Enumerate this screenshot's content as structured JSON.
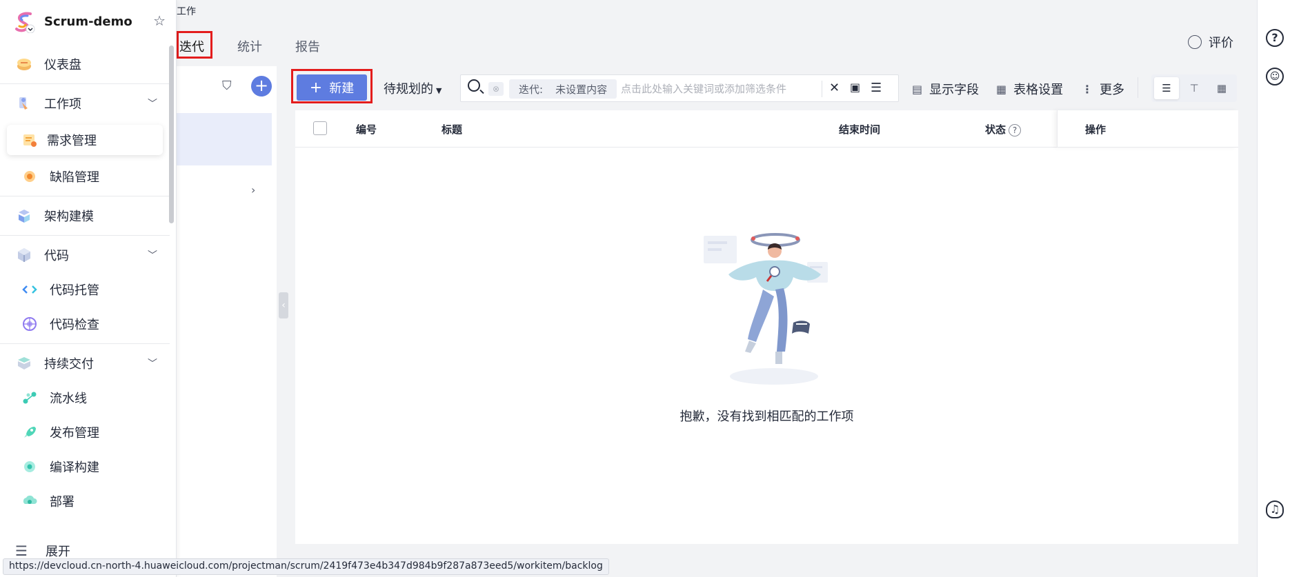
{
  "project": {
    "name": "Scrum-demo"
  },
  "sidebar": {
    "items": [
      {
        "label": "仪表盘"
      },
      {
        "label": "工作项"
      },
      {
        "label": "需求管理"
      },
      {
        "label": "缺陷管理"
      },
      {
        "label": "架构建模"
      },
      {
        "label": "代码"
      },
      {
        "label": "代码托管"
      },
      {
        "label": "代码检查"
      },
      {
        "label": "持续交付"
      },
      {
        "label": "流水线"
      },
      {
        "label": "发布管理"
      },
      {
        "label": "编译构建"
      },
      {
        "label": "部署"
      }
    ],
    "expand_label": "展开"
  },
  "breadcrumb": "工作",
  "tabs": [
    {
      "label": "迭代"
    },
    {
      "label": "统计"
    },
    {
      "label": "报告"
    }
  ],
  "header": {
    "rate_label": "评价"
  },
  "toolbar": {
    "new_label": "新建",
    "plan_filter": "待规划的",
    "search": {
      "chip_key": "迭代:",
      "chip_value": "未设置内容",
      "placeholder": "点击此处输入关键词或添加筛选条件"
    },
    "show_fields": "显示字段",
    "table_settings": "表格设置",
    "more": "更多"
  },
  "table": {
    "columns": [
      "编号",
      "标题",
      "结束时间",
      "状态",
      "操作"
    ],
    "empty_text": "抱歉，没有找到相匹配的工作项"
  },
  "status_url": "https://devcloud.cn-north-4.huaweicloud.com/projectman/scrum/2419f473e4b347d984b9f287a873eed5/workitem/backlog",
  "colors": {
    "primary": "#5e7ce0",
    "highlight": "#e31c1c"
  }
}
